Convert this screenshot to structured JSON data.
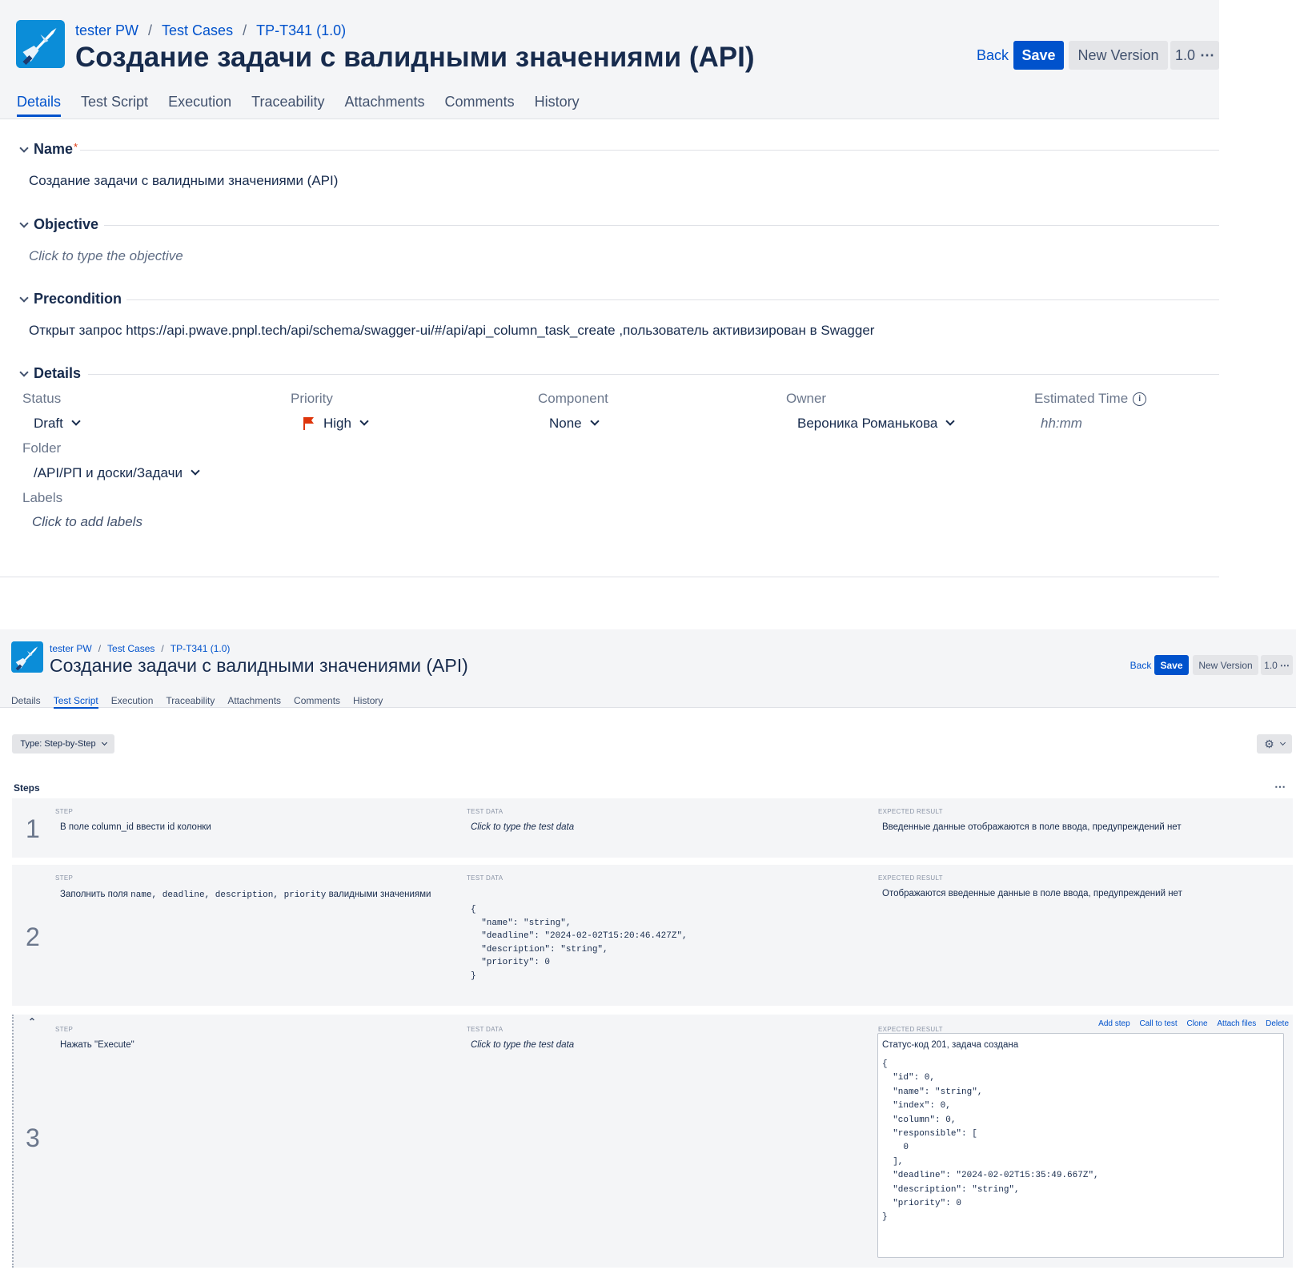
{
  "header": {
    "breadcrumb": [
      "tester PW",
      "Test Cases",
      "TP-T341 (1.0)"
    ],
    "title": "Создание задачи с валидными значениями (API)",
    "back_label": "Back",
    "save_label": "Save",
    "new_version_label": "New Version",
    "version_label": "1.0"
  },
  "tabs": [
    "Details",
    "Test Script",
    "Execution",
    "Traceability",
    "Attachments",
    "Comments",
    "History"
  ],
  "details": {
    "name_label": "Name",
    "name_required": "*",
    "name_value": "Создание задачи с валидными значениями  (API)",
    "objective_label": "Objective",
    "objective_placeholder": "Click to type the objective",
    "precondition_label": "Precondition",
    "precondition_value": "Открыт запрос https://api.pwave.pnpl.tech/api/schema/swagger-ui/#/api/api_column_task_create  ,пользователь активизирован в Swagger",
    "details_label": "Details",
    "fields": {
      "status_label": "Status",
      "status_value": "Draft",
      "priority_label": "Priority",
      "priority_value": "High",
      "component_label": "Component",
      "component_value": "None",
      "owner_label": "Owner",
      "owner_value": "Вероника Романькова",
      "estimated_label": "Estimated Time",
      "estimated_placeholder": "hh:mm",
      "folder_label": "Folder",
      "folder_value": "/API/РП и доски/Задачи",
      "labels_label": "Labels",
      "labels_placeholder": "Click to add labels"
    },
    "priority_color": "#de350b"
  },
  "script": {
    "type_label": "Type: Step-by-Step",
    "steps_label": "Steps",
    "col_step": "STEP",
    "col_test_data": "TEST DATA",
    "col_expected": "EXPECTED RESULT",
    "test_data_placeholder": "Click to type the test data",
    "actions": [
      "Add step",
      "Call to test",
      "Clone",
      "Attach files",
      "Delete"
    ],
    "steps": [
      {
        "num": "1",
        "step": "В поле column_id   ввести id колонки",
        "expected": "Введенные данные отображаются в поле ввода, предупреждений нет"
      },
      {
        "num": "2",
        "step_prefix": "Заполнить поля ",
        "step_code": "name, deadline, description, priority",
        "step_suffix": "  валидными значениями",
        "test_data": "{\n  \"name\": \"string\",\n  \"deadline\": \"2024-02-02T15:20:46.427Z\",\n  \"description\": \"string\",\n  \"priority\": 0\n}",
        "expected": "Отображаются введенные данные в поле ввода, предупреждений нет"
      },
      {
        "num": "3",
        "step": "Нажать \"Execute\"",
        "expected_title": "Статус-код 201, задача  создана",
        "expected_code": "{\n  \"id\": 0,\n  \"name\": \"string\",\n  \"index\": 0,\n  \"column\": 0,\n  \"responsible\": [\n    0\n  ],\n  \"deadline\": \"2024-02-02T15:35:49.667Z\",\n  \"description\": \"string\",\n  \"priority\": 0\n}"
      }
    ]
  },
  "colors": {
    "accent": "#0052cc",
    "header_bg": "#f4f5f7",
    "logo_bg": "#0b8dd8"
  }
}
